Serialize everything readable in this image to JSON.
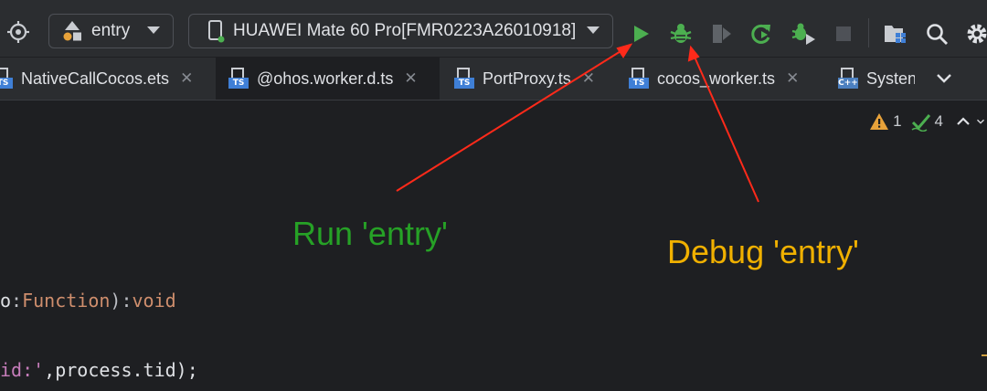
{
  "toolbar": {
    "run_config": "entry",
    "device": "HUAWEI Mate 60 Pro[FMR0223A26010918]"
  },
  "tabs": [
    {
      "label": "NativeCallCocos.ets",
      "icon": "TS",
      "active": false
    },
    {
      "label": "@ohos.worker.d.ts",
      "icon": "TS",
      "active": true
    },
    {
      "label": "PortProxy.ts",
      "icon": "TS",
      "active": false
    },
    {
      "label": "cocos_worker.ts",
      "icon": "TS",
      "active": false
    },
    {
      "label": "Systen",
      "icon": "C++",
      "active": false
    }
  ],
  "inspections": {
    "warnings": "1",
    "ok": "4"
  },
  "code": {
    "line1": {
      "a": "o",
      "b": ":",
      "c": "Function",
      "d": "):",
      "e": "void"
    },
    "line2": {
      "a": "id:'",
      "b": ",process.",
      "c": "tid",
      "d": ");"
    }
  },
  "annotations": {
    "run": "Run 'entry'",
    "debug": "Debug 'entry'"
  },
  "colors": {
    "run_green": "#26a126",
    "debug_yellow": "#f0b000",
    "arrow_red": "#ff2a1a"
  }
}
